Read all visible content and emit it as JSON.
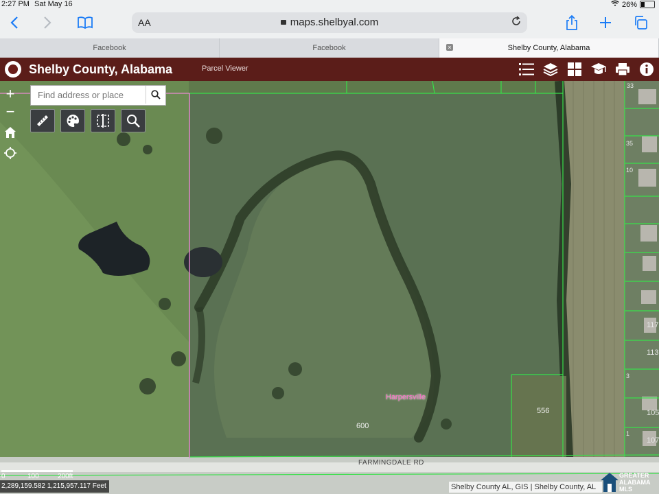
{
  "status_bar": {
    "time": "2:27 PM",
    "date": "Sat May 16",
    "battery": "26%",
    "battery_fraction": 0.26
  },
  "browser": {
    "text_size_label": "AA",
    "url": "maps.shelbyal.com",
    "tabs": [
      {
        "label": "Facebook",
        "active": false
      },
      {
        "label": "Facebook",
        "active": false
      },
      {
        "label": "Shelby County, Alabama",
        "active": true
      }
    ]
  },
  "app": {
    "title": "Shelby County, Alabama",
    "subtitle": "Parcel Viewer",
    "header_icons": [
      "list-icon",
      "layers-icon",
      "basemap-grid-icon",
      "school-icon",
      "print-icon",
      "info-icon"
    ]
  },
  "map": {
    "search_placeholder": "Find address or place",
    "tools": [
      "measure-icon",
      "palette-icon",
      "compare-icon",
      "zoom-search-icon"
    ],
    "zoom_in": "+",
    "zoom_out": "−",
    "parcel_labels": {
      "l600": "600",
      "l556": "556",
      "r33": "33",
      "r35": "35",
      "r10": "10",
      "r117": "117",
      "r113": "113",
      "r3": "3",
      "r105": "105",
      "r1": "1",
      "r107": "107"
    },
    "town_label": "Harpersville",
    "road_label": "FARMINGDALE RD",
    "scale": {
      "zero": "0",
      "mid": "100",
      "end": "200ft"
    },
    "coordinates": "2,289,159.582 1,215,957.117 Feet",
    "attribution": "Shelby County AL, GIS | Shelby County, AL",
    "mls_logo_line1": "GREATER",
    "mls_logo_line2": "ALABAMA",
    "mls_logo_line3": "MLS"
  }
}
